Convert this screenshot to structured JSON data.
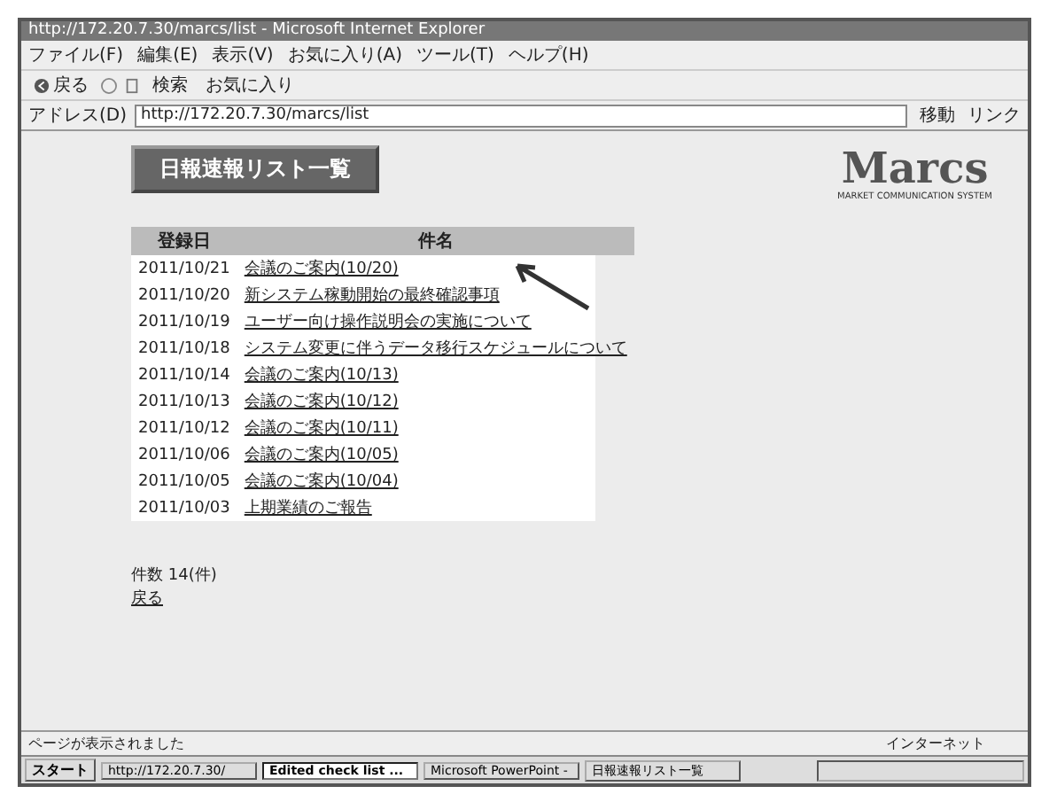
{
  "window": {
    "title": "http://172.20.7.30/marcs/list - Microsoft Internet Explorer"
  },
  "menu": [
    "ファイル(F)",
    "編集(E)",
    "表示(V)",
    "お気に入り(A)",
    "ツール(T)",
    "ヘルプ(H)"
  ],
  "toolbar": {
    "back": "戻る",
    "search": "検索",
    "favorites": "お気に入り"
  },
  "address": {
    "label": "アドレス(D)",
    "value": "http://172.20.7.30/marcs/list",
    "go": "移動",
    "links": "リンク"
  },
  "banner": "日報速報リスト一覧",
  "logo": {
    "name": "Marcs",
    "tagline": "MARKET COMMUNICATION SYSTEM"
  },
  "table": {
    "columns": [
      "登録日",
      "件名"
    ],
    "rows": [
      {
        "date": "2011/10/21",
        "subject": "会議のご案内(10/20)"
      },
      {
        "date": "2011/10/20",
        "subject": "新システム稼動開始の最終確認事項"
      },
      {
        "date": "2011/10/19",
        "subject": "ユーザー向け操作説明会の実施について"
      },
      {
        "date": "2011/10/18",
        "subject": "システム変更に伴うデータ移行スケジュールについて"
      },
      {
        "date": "2011/10/14",
        "subject": "会議のご案内(10/13)"
      },
      {
        "date": "2011/10/13",
        "subject": "会議のご案内(10/12)"
      },
      {
        "date": "2011/10/12",
        "subject": "会議のご案内(10/11)"
      },
      {
        "date": "2011/10/06",
        "subject": "会議のご案内(10/05)"
      },
      {
        "date": "2011/10/05",
        "subject": "会議のご案内(10/04)"
      },
      {
        "date": "2011/10/03",
        "subject": "上期業績のご報告"
      }
    ]
  },
  "count": "件数 14(件)",
  "back_link": "戻る",
  "status_bar": {
    "text": "ページが表示されました",
    "zone": "インターネット"
  },
  "taskbar": {
    "start": "スタート",
    "tasks": [
      {
        "label": "http://172.20.7.30/",
        "selected": false
      },
      {
        "label": "Edited check list ...",
        "selected": true
      },
      {
        "label": "Microsoft PowerPoint -",
        "selected": false
      },
      {
        "label": "日報速報リスト一覧",
        "selected": false
      }
    ]
  }
}
